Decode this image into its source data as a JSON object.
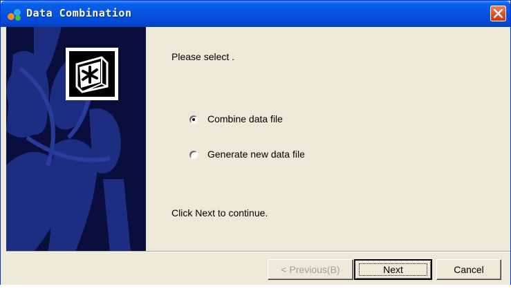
{
  "window": {
    "title": "Data Combination",
    "app_icon": "app-icon",
    "close_icon": "close-icon"
  },
  "side_panel": {
    "logo_icon": "asterisk-logo-icon"
  },
  "main": {
    "prompt": "Please select .",
    "options": [
      {
        "label": "Combine data file",
        "checked": true
      },
      {
        "label": "Generate new data file",
        "checked": false
      }
    ],
    "hint": "Click Next to continue."
  },
  "buttons": {
    "previous_label": "< Previous(B)",
    "next_label": "Next",
    "cancel_label": "Cancel"
  },
  "colors": {
    "title_bar": "#0553e0",
    "side_panel": "#0a0e3c",
    "dialog_face": "#ece9d8",
    "close_button": "#e04a20"
  }
}
